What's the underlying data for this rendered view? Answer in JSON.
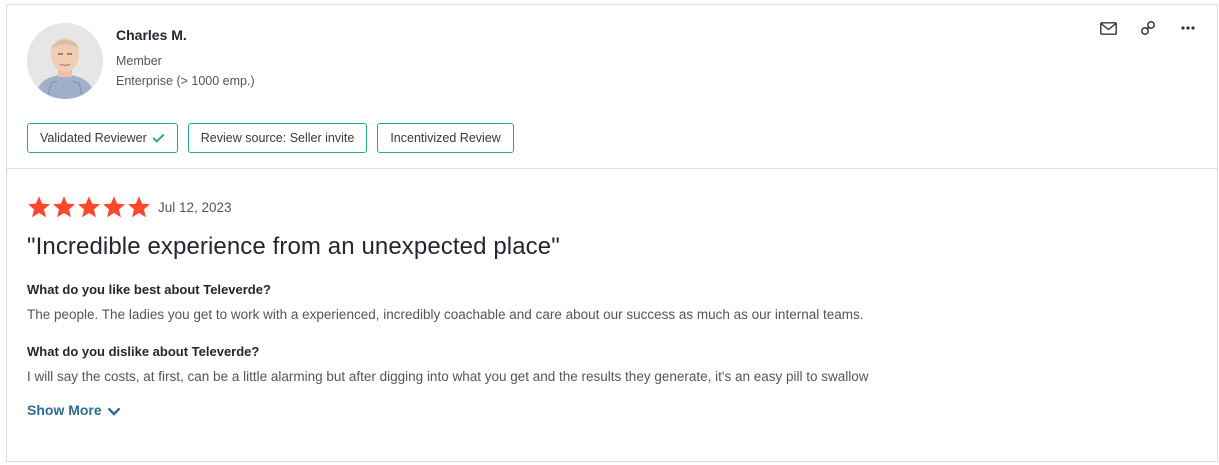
{
  "reviewer": {
    "name": "Charles M.",
    "role": "Member",
    "company_size": "Enterprise (> 1000 emp.)"
  },
  "actions": {
    "email_icon": "envelope-icon",
    "link_icon": "link-icon",
    "more_icon": "more-horizontal-icon"
  },
  "badges": [
    {
      "label": "Validated Reviewer",
      "icon": "check-icon"
    },
    {
      "label": "Review source: Seller invite"
    },
    {
      "label": "Incentivized Review"
    }
  ],
  "review": {
    "rating": 5,
    "max_rating": 5,
    "date": "Jul 12, 2023",
    "title": "\"Incredible experience from an unexpected place\"",
    "like_question": "What do you like best about Televerde?",
    "like_answer": "The people. The ladies you get to work with a experienced, incredibly coachable and care about our success as much as our internal teams.",
    "dislike_question": "What do you dislike about Televerde?",
    "dislike_answer": "I will say the costs, at first, can be a little alarming but after digging into what you get and the results they generate, it's an easy pill to swallow",
    "show_more_label": "Show More"
  },
  "colors": {
    "star": "#ff492c",
    "badge_border": "#27a98f",
    "check": "#27a98f",
    "link": "#2e6b8f"
  }
}
